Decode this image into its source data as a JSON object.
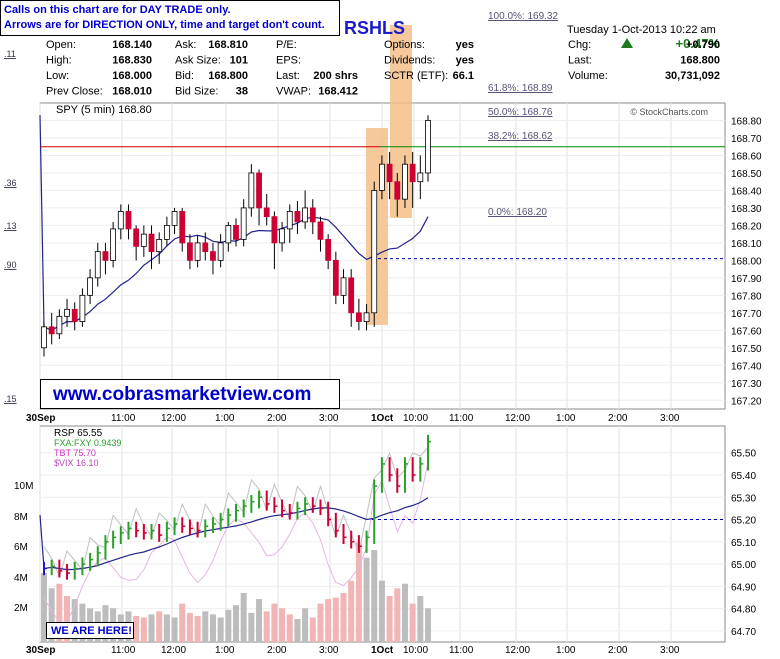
{
  "annotations": {
    "note_line1": "Calls on this chart are for DAY TRADE only.",
    "note_line2": "Arrows are for DIRECTION ONLY, time and target don't count.",
    "website": "www.cobrasmarketview.com",
    "we_are_here": "WE ARE HERE!",
    "title_fragment": "RSHLS",
    "source": "© StockCharts.com"
  },
  "header": {
    "date": "Tuesday  1-Oct-2013  10:22 am",
    "pct_change": "+0.47%",
    "rows": [
      [
        "Open:",
        "168.140",
        "Ask:",
        "168.810",
        "P/E:",
        "",
        "Options:",
        "yes",
        "Chg:",
        "+0.790"
      ],
      [
        "High:",
        "168.830",
        "Ask Size:",
        "101",
        "EPS:",
        "",
        "Dividends:",
        "yes",
        "Last:",
        "168.800"
      ],
      [
        "Low:",
        "168.000",
        "Bid:",
        "168.800",
        "Last:",
        "200 shrs",
        "SCTR (ETF):",
        "66.1",
        "Volume:",
        "30,731,092"
      ],
      [
        "Prev Close:",
        "168.010",
        "Bid Size:",
        "38",
        "VWAP:",
        "168.412",
        "",
        "",
        "",
        ""
      ]
    ]
  },
  "colors": {
    "up": "#2aa02a",
    "down": "#cc0033",
    "neutral": "#1a1acc",
    "highlight": "#f5c089",
    "ma": "#23238e",
    "resistance": "#cc0000",
    "support": "#008800",
    "fib": "#555577",
    "dashed": "#0000aa",
    "tbt": "#cc33cc",
    "fxa": "#2aa02a",
    "vix": "#bb44bb"
  },
  "chart_data": [
    {
      "type": "candlestick",
      "legend": "SPY (5 min) 168.80",
      "ylim": [
        167.15,
        168.9
      ],
      "y_ticks": [
        "168.80",
        "168.70",
        "168.60",
        "168.50",
        "168.40",
        "168.30",
        "168.20",
        "168.10",
        "168.00",
        "167.90",
        "167.80",
        "167.70",
        "167.60",
        "167.50",
        "167.40",
        "167.30",
        "167.20"
      ],
      "left_ticks": [
        ".11",
        ".36",
        ".13",
        ".90",
        ".15"
      ],
      "x_labels": [
        "30Sep",
        "11:00",
        "12:00",
        "1:00",
        "2:00",
        "3:00",
        "1Oct",
        "10:00",
        "11:00",
        "12:00",
        "1:00",
        "2:00",
        "3:00"
      ],
      "fib_levels": [
        {
          "label": "100.0%: 169.32",
          "value": 169.32
        },
        {
          "label": "61.8%: 168.89",
          "value": 168.89
        },
        {
          "label": "50.0%: 168.76",
          "value": 168.76
        },
        {
          "label": "38.2%: 168.62",
          "value": 168.62
        },
        {
          "label": "0.0%: 168.20",
          "value": 168.2
        }
      ],
      "resistance": 168.65,
      "support_dashed": 168.01,
      "candles": [
        [
          167.5,
          167.62,
          167.45,
          167.65
        ],
        [
          167.62,
          167.58,
          167.52,
          167.7
        ],
        [
          167.58,
          167.68,
          167.55,
          167.72
        ],
        [
          167.68,
          167.72,
          167.62,
          167.78
        ],
        [
          167.72,
          167.65,
          167.6,
          167.76
        ],
        [
          167.65,
          167.8,
          167.62,
          167.84
        ],
        [
          167.8,
          167.9,
          167.75,
          167.95
        ],
        [
          167.9,
          168.05,
          167.85,
          168.1
        ],
        [
          168.05,
          168.0,
          167.92,
          168.1
        ],
        [
          168.0,
          168.18,
          167.96,
          168.22
        ],
        [
          168.18,
          168.28,
          168.12,
          168.32
        ],
        [
          168.28,
          168.18,
          168.12,
          168.32
        ],
        [
          168.18,
          168.08,
          168.0,
          168.2
        ],
        [
          168.08,
          168.15,
          168.02,
          168.2
        ],
        [
          168.15,
          168.05,
          167.95,
          168.2
        ],
        [
          168.05,
          168.12,
          167.98,
          168.16
        ],
        [
          168.12,
          168.2,
          168.08,
          168.25
        ],
        [
          168.2,
          168.28,
          168.15,
          168.3
        ],
        [
          168.28,
          168.1,
          168.05,
          168.3
        ],
        [
          168.1,
          168.0,
          167.95,
          168.15
        ],
        [
          168.0,
          168.1,
          167.96,
          168.14
        ],
        [
          168.1,
          168.05,
          168.0,
          168.16
        ],
        [
          168.05,
          168.0,
          167.92,
          168.1
        ],
        [
          168.0,
          168.1,
          167.96,
          168.15
        ],
        [
          168.1,
          168.2,
          168.05,
          168.22
        ],
        [
          168.2,
          168.12,
          168.08,
          168.24
        ],
        [
          168.12,
          168.3,
          168.08,
          168.35
        ],
        [
          168.3,
          168.5,
          168.25,
          168.55
        ],
        [
          168.5,
          168.3,
          168.2,
          168.52
        ],
        [
          168.3,
          168.25,
          168.2,
          168.38
        ],
        [
          168.25,
          168.1,
          167.95,
          168.28
        ],
        [
          168.1,
          168.18,
          168.05,
          168.22
        ],
        [
          168.18,
          168.28,
          168.1,
          168.32
        ],
        [
          168.28,
          168.22,
          168.15,
          168.34
        ],
        [
          168.22,
          168.3,
          168.18,
          168.4
        ],
        [
          168.3,
          168.22,
          168.15,
          168.35
        ],
        [
          168.22,
          168.12,
          168.05,
          168.25
        ],
        [
          168.12,
          168.0,
          167.95,
          168.15
        ],
        [
          168.0,
          167.8,
          167.75,
          168.05
        ],
        [
          167.8,
          167.9,
          167.75,
          167.95
        ],
        [
          167.9,
          167.7,
          167.62,
          167.95
        ],
        [
          167.7,
          167.65,
          167.6,
          167.78
        ],
        [
          167.65,
          167.7,
          167.6,
          167.75
        ],
        [
          167.7,
          168.4,
          167.62,
          168.45
        ],
        [
          168.4,
          168.55,
          168.35,
          168.6
        ],
        [
          168.55,
          168.45,
          168.35,
          168.62
        ],
        [
          168.45,
          168.35,
          168.25,
          168.5
        ],
        [
          168.35,
          168.55,
          168.3,
          168.6
        ],
        [
          168.55,
          168.45,
          168.3,
          168.62
        ],
        [
          168.45,
          168.5,
          168.35,
          168.6
        ],
        [
          168.5,
          168.8,
          168.45,
          168.83
        ]
      ]
    },
    {
      "type": "bar",
      "legend": [
        "RSP 65.55",
        "FXA:FXY 0.9439",
        "TBT 75.70",
        "$VIX 16.10"
      ],
      "ylim": [
        64.65,
        65.62
      ],
      "y_ticks": [
        "65.50",
        "65.40",
        "65.30",
        "65.20",
        "65.10",
        "65.00",
        "64.90",
        "64.80",
        "64.70"
      ],
      "volume_ticks": [
        "10M",
        "8M",
        "6M",
        "4M",
        "2M"
      ],
      "x_labels": [
        "30Sep",
        "11:00",
        "12:00",
        "1:00",
        "2:00",
        "3:00",
        "1Oct",
        "10:00",
        "11:00",
        "12:00",
        "1:00",
        "2:00",
        "3:00"
      ],
      "support_dashed": 65.2,
      "rsp_close": [
        64.98,
        64.99,
        64.97,
        64.96,
        64.98,
        65.0,
        65.02,
        65.05,
        65.1,
        65.12,
        65.14,
        65.16,
        65.15,
        65.14,
        65.15,
        65.13,
        65.16,
        65.18,
        65.17,
        65.16,
        65.15,
        65.17,
        65.18,
        65.2,
        65.22,
        65.24,
        65.26,
        65.28,
        65.3,
        65.27,
        65.26,
        65.24,
        65.23,
        65.25,
        65.27,
        65.26,
        65.25,
        65.2,
        65.15,
        65.12,
        65.1,
        65.08,
        65.12,
        65.35,
        65.45,
        65.4,
        65.35,
        65.45,
        65.4,
        65.45,
        65.55
      ],
      "volume": [
        4.5,
        3.5,
        3.8,
        3.0,
        2.8,
        2.5,
        2.2,
        2.0,
        2.4,
        2.2,
        1.8,
        2.0,
        1.7,
        1.6,
        1.8,
        2.0,
        1.8,
        1.6,
        2.5,
        1.9,
        1.7,
        2.0,
        1.8,
        1.6,
        2.1,
        2.4,
        3.2,
        1.9,
        2.8,
        2.0,
        2.5,
        2.2,
        1.8,
        1.5,
        2.2,
        1.6,
        2.5,
        2.8,
        2.9,
        3.2,
        4.0,
        6.5,
        5.5,
        6.0,
        4.0,
        3.0,
        3.5,
        3.8,
        2.5,
        3.0,
        2.2
      ]
    }
  ]
}
